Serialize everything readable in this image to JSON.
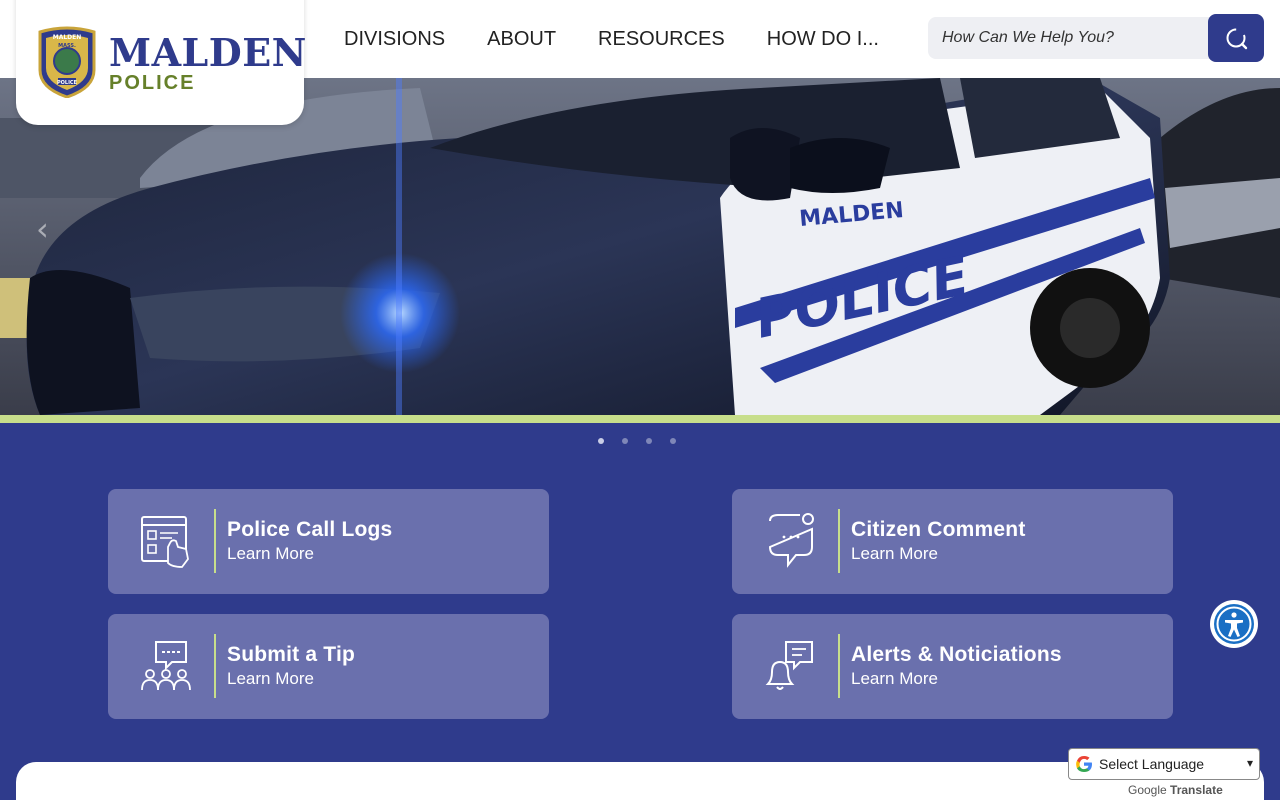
{
  "brand": {
    "title": "MALDEN",
    "subtitle": "POLICE",
    "badge_top": "MALDEN",
    "badge_mid": "MASS.",
    "badge_bottom": "POLICE"
  },
  "nav": {
    "items": [
      {
        "label": "DIVISIONS"
      },
      {
        "label": "ABOUT"
      },
      {
        "label": "RESOURCES"
      },
      {
        "label": "HOW DO I..."
      }
    ]
  },
  "search": {
    "placeholder": "How Can We Help You?"
  },
  "hero": {
    "door_text": "MALDEN",
    "side_text": "POLICE",
    "slides_total": 4,
    "active_slide": 1
  },
  "cards": [
    {
      "title": "Police Call Logs",
      "link": "Learn More",
      "icon": "call-logs-icon"
    },
    {
      "title": "Citizen Comment",
      "link": "Learn More",
      "icon": "comment-bubble-icon"
    },
    {
      "title": "Submit a Tip",
      "link": "Learn More",
      "icon": "tip-people-icon"
    },
    {
      "title": "Alerts & Noticiations",
      "link": "Learn More",
      "icon": "alert-bell-icon"
    }
  ],
  "translate": {
    "select_label": "Select Language",
    "powered_by": "Google",
    "translate_word": "Translate"
  },
  "colors": {
    "primary": "#2f3b8c",
    "card": "#6a70ad",
    "accent_green": "#c7de8b",
    "brand_green": "#66802a"
  }
}
